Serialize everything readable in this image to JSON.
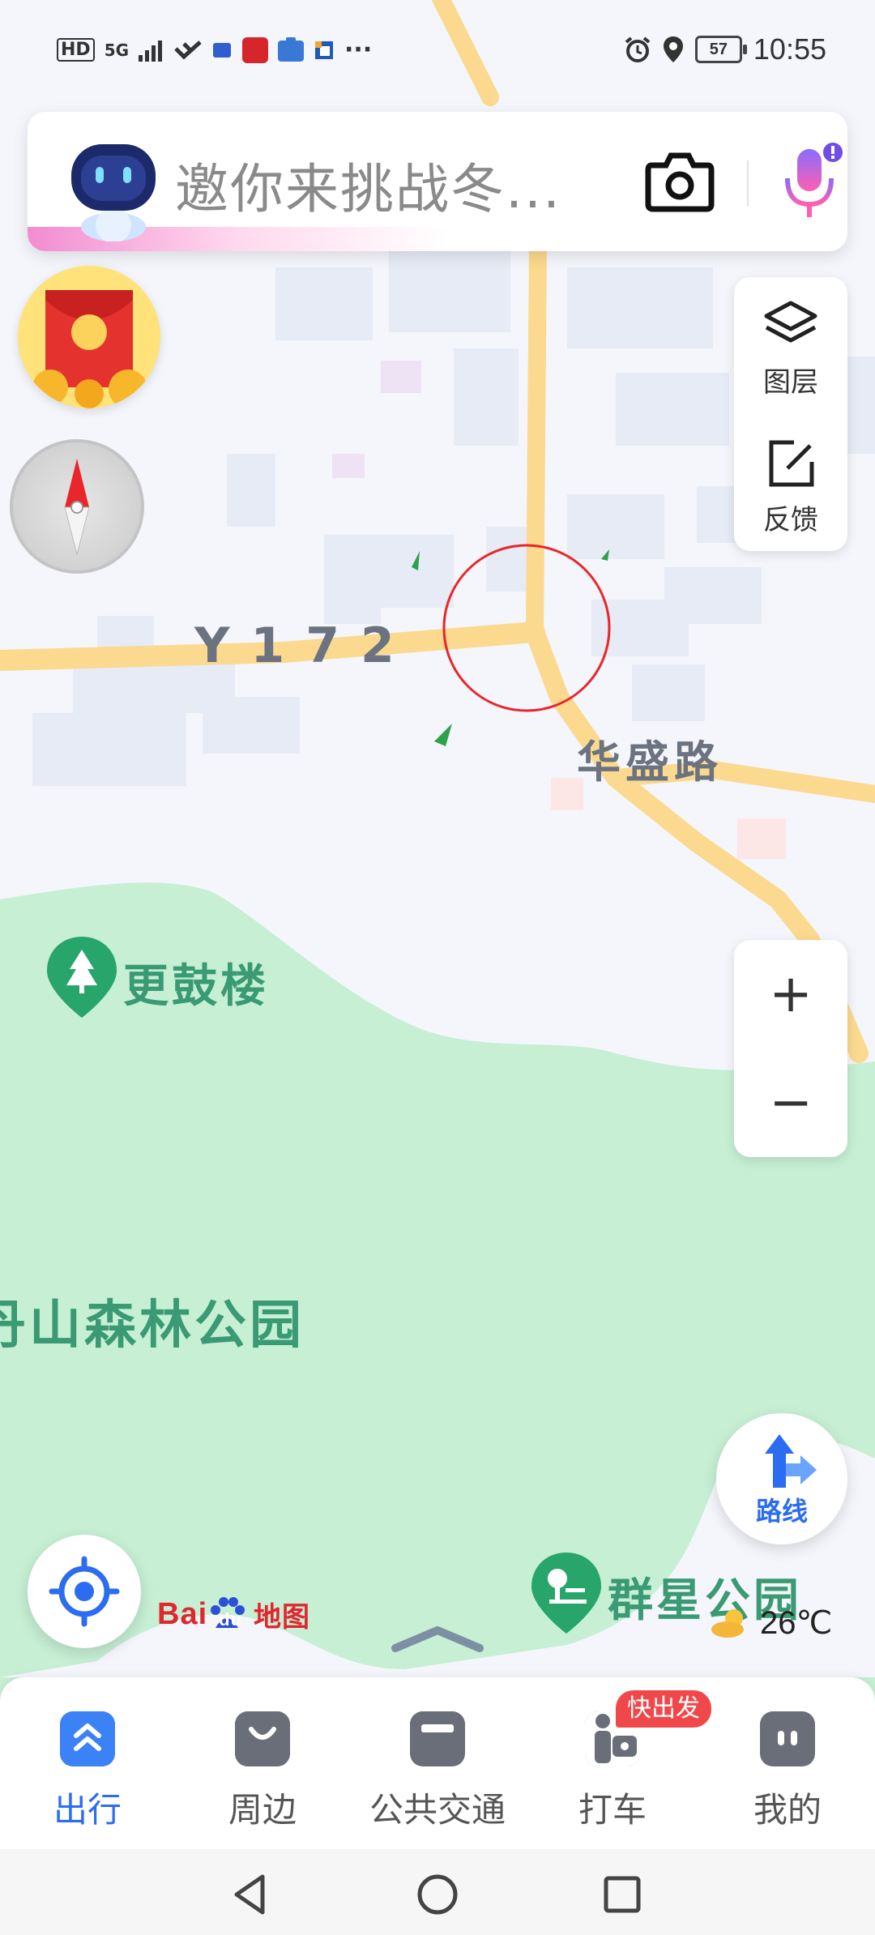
{
  "status_bar": {
    "left_icons": [
      "HD",
      "5G",
      "signal-icon",
      "wifi-icon",
      "app-icon-1",
      "app-icon-2",
      "app-icon-3",
      "app-icon-4",
      "more-dots-icon"
    ],
    "hd_label": "HD",
    "net_label": "5G",
    "more": "···",
    "battery": "57",
    "time": "10:55"
  },
  "search": {
    "placeholder": "邀你来挑战冬..."
  },
  "tools": {
    "layers_label": "图层",
    "feedback_label": "反馈"
  },
  "zoom": {
    "in_label": "+",
    "out_label": "−"
  },
  "map": {
    "road_y172": "Y172",
    "road_huasheng": "华盛路",
    "poi_gengulou": "更鼓楼",
    "park_forest": "丹山森林公园",
    "poi_qunxing": "群星公园",
    "colors": {
      "road": "#fbd98e",
      "park": "#c6efd4",
      "poi_green": "#27a56a",
      "marker_circle": "#e8262b"
    }
  },
  "route": {
    "label": "路线"
  },
  "branding": {
    "logo_bai": "Bai",
    "logo_du": "du",
    "logo_map": "地图"
  },
  "weather": {
    "icon": "sun-cloud-icon",
    "temperature": "26℃"
  },
  "bottom_nav": {
    "items": [
      {
        "label": "出行",
        "active": true
      },
      {
        "label": "周边",
        "active": false
      },
      {
        "label": "公共交通",
        "active": false
      },
      {
        "label": "打车",
        "active": false
      },
      {
        "label": "我的",
        "active": false
      }
    ],
    "taxi_badge": "快出发"
  },
  "system_nav": [
    "back-icon",
    "home-icon",
    "recents-icon"
  ]
}
